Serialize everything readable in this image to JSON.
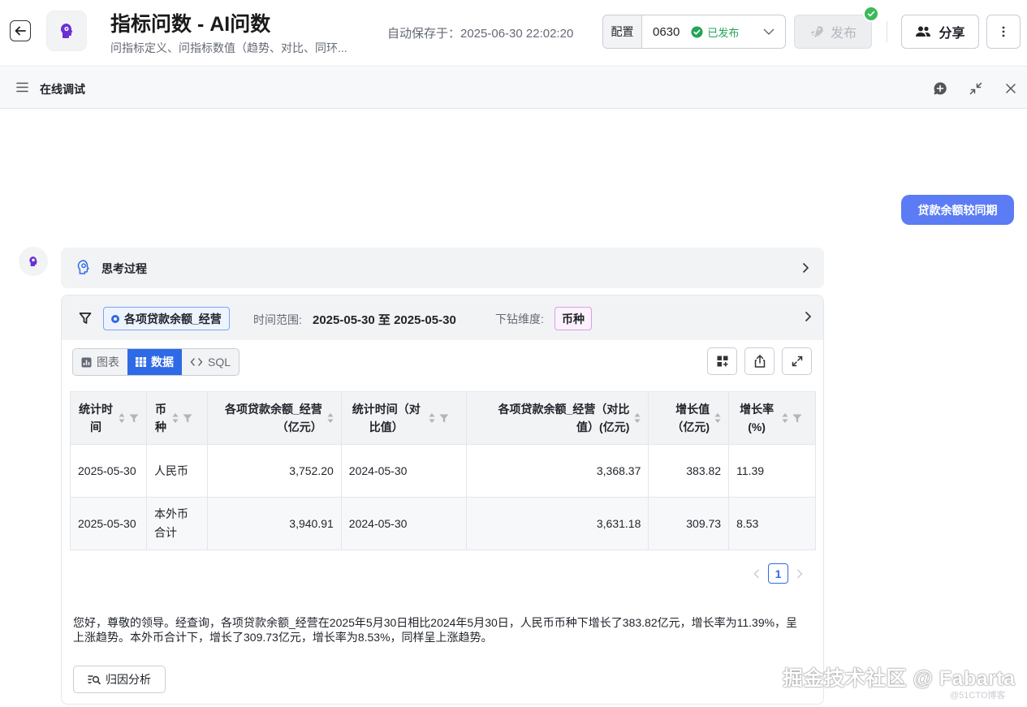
{
  "header": {
    "title": "指标问数 - AI问数",
    "subtitle": "问指标定义、问指标数值（趋势、对比、同环...",
    "autosave": "自动保存于：2025-06-30 22:02:20",
    "config_label": "配置",
    "config_version": "0630",
    "config_status": "已发布",
    "publish_label": "发布",
    "share_label": "分享"
  },
  "debug_panel": {
    "title": "在线调试"
  },
  "chat": {
    "user_message": "贷款余额较同期",
    "thinking_label": "思考过程",
    "filter": {
      "metric": "各项贷款余额_经营",
      "time_label": "时间范围:",
      "time_value": "2025-05-30 至 2025-05-30",
      "drill_label": "下钻维度:",
      "drill_value": "币种"
    },
    "view_tabs": [
      {
        "label": "图表",
        "icon": "bar-chart-icon"
      },
      {
        "label": "数据",
        "icon": "grid-icon"
      },
      {
        "label": "SQL",
        "icon": "code-icon"
      }
    ],
    "active_tab": "数据",
    "table": {
      "columns": [
        {
          "label": "统计时间"
        },
        {
          "label": "币种"
        },
        {
          "label": "各项贷款余额_经营（亿元）"
        },
        {
          "label": "统计时间（对比值）"
        },
        {
          "label": "各项贷款余额_经营（对比值）(亿元)"
        },
        {
          "label": "增长值（亿元)"
        },
        {
          "label": "增长率(%)"
        }
      ],
      "rows": [
        [
          "2025-05-30",
          "人民币",
          "3,752.20",
          "2024-05-30",
          "3,368.37",
          "383.82",
          "11.39"
        ],
        [
          "2025-05-30",
          "本外币合计",
          "3,940.91",
          "2024-05-30",
          "3,631.18",
          "309.73",
          "8.53"
        ]
      ]
    },
    "pagination": {
      "current": "1"
    },
    "summary": "您好，尊敬的领导。经查询，各项贷款余额_经营在2025年5月30日相比2024年5月30日，人民币币种下增长了383.82亿元，增长率为11.39%，呈上涨趋势。本外币合计下，增长了309.73亿元，增长率为8.53%，同样呈上涨趋势。",
    "attribution_label": "归因分析"
  },
  "watermark": {
    "main": "掘金技术社区 @ Fabarta",
    "sub": "@51CTO博客"
  },
  "colors": {
    "accent": "#2f6ae6",
    "user_bubble": "#5b7cf4",
    "published_green": "#23a457"
  }
}
